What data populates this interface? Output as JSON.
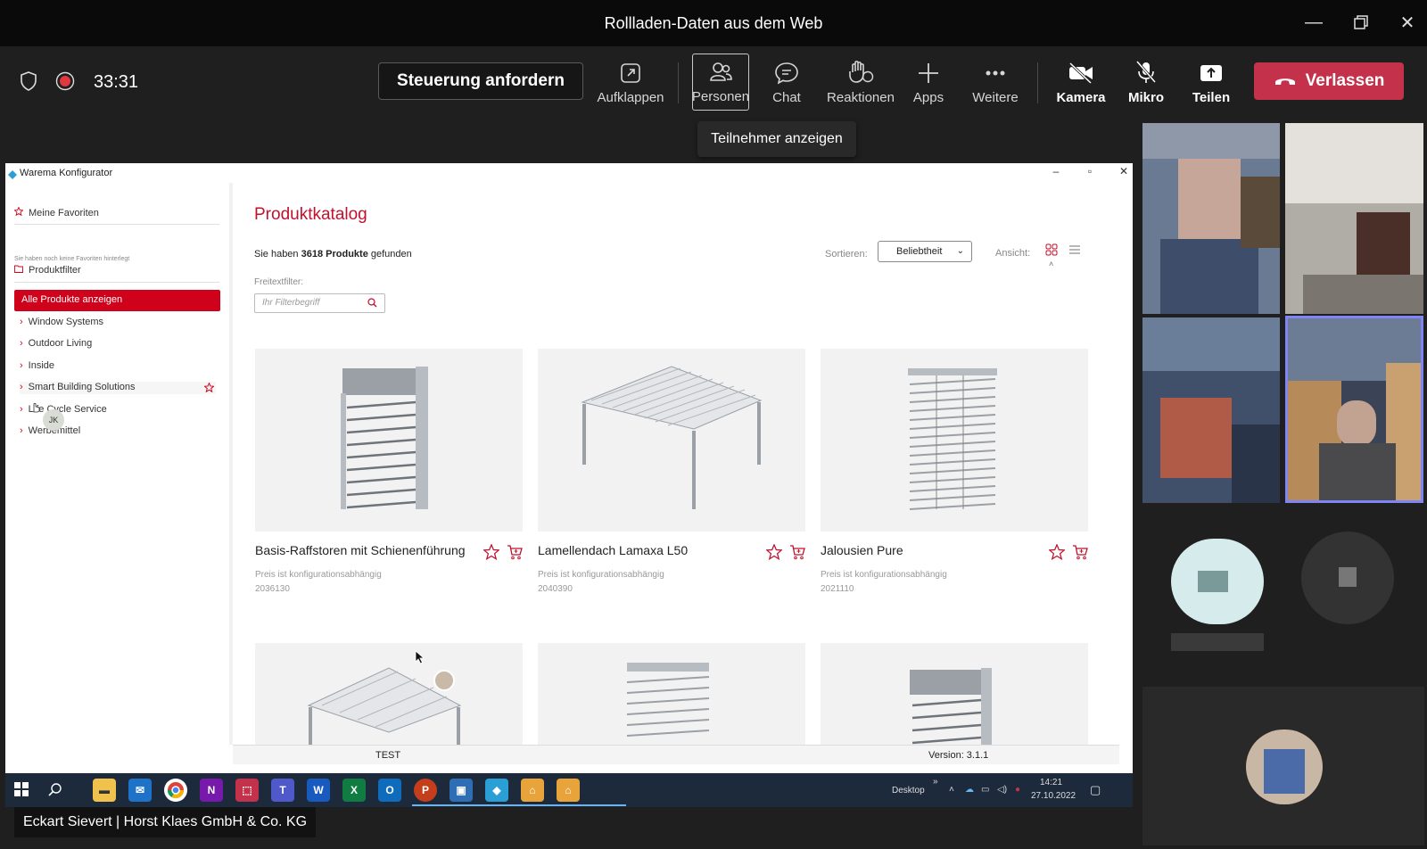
{
  "window": {
    "title": "Rollladen-Daten aus dem Web"
  },
  "meeting": {
    "timer": "33:31",
    "request_control": "Steuerung anfordern",
    "toolbar": {
      "popout": "Aufklappen",
      "people": "Personen",
      "chat": "Chat",
      "reactions": "Reaktionen",
      "apps": "Apps",
      "more": "Weitere",
      "camera": "Kamera",
      "mic": "Mikro",
      "share": "Teilen",
      "leave": "Verlassen"
    },
    "tooltip": "Teilnehmer anzeigen",
    "presenter": "Eckart Sievert | Horst Klaes GmbH & Co. KG"
  },
  "app": {
    "title": "Warema Konfigurator",
    "sidebar": {
      "favorites_title": "Meine Favoriten",
      "favorites_note": "Sie haben noch keine Favoriten hinterlegt",
      "filter_title": "Produktfilter",
      "all_products": "Alle Produkte anzeigen",
      "items": [
        {
          "label": "Window Systems"
        },
        {
          "label": "Outdoor Living"
        },
        {
          "label": "Inside"
        },
        {
          "label": "Smart Building Solutions"
        },
        {
          "label": "Life Cycle Service"
        },
        {
          "label": "Werbemittel"
        }
      ],
      "cursor_badge": "JK"
    },
    "catalog": {
      "title": "Produktkatalog",
      "found_prefix": "Sie haben",
      "found_count": "3618 Produkte",
      "found_suffix": "gefunden",
      "freetext_label": "Freitextfilter:",
      "search_placeholder": "Ihr Filterbegriff",
      "sort_label": "Sortieren:",
      "sort_value": "Beliebtheit",
      "view_label": "Ansicht:",
      "products": [
        {
          "name": "Basis-Raffstoren mit Schienenführung",
          "price": "Preis ist konfigurationsabhängig",
          "number": "2036130"
        },
        {
          "name": "Lamellendach Lamaxa L50",
          "price": "Preis ist konfigurationsabhängig",
          "number": "2040390"
        },
        {
          "name": "Jalousien Pure",
          "price": "Preis ist konfigurationsabhängig",
          "number": "2021110"
        }
      ]
    },
    "status": {
      "left": "TEST",
      "right": "Version: 3.1.1"
    }
  },
  "taskbar": {
    "desktop_label": "Desktop",
    "time": "14:21",
    "date": "27.10.2022"
  },
  "colors": {
    "accent_red": "#d0021b",
    "leave_red": "#c4314b",
    "active_tile": "#7f85f5",
    "titlebar": "#0a0a0a",
    "taskbar": "#1c2a3c"
  }
}
